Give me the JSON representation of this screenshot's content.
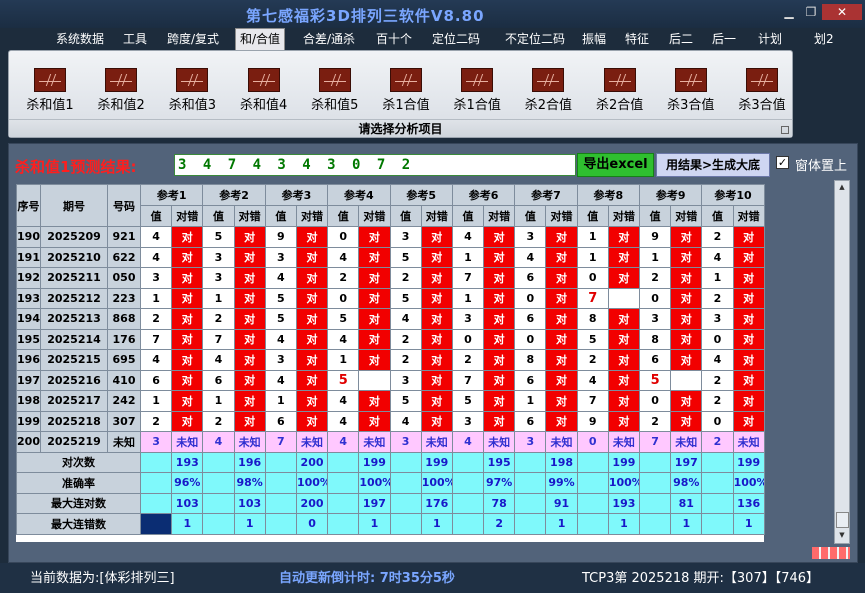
{
  "app": {
    "title": "第七感福彩3D排列三软件V8.80"
  },
  "window_icons": [
    "minimize-icon",
    "restore-icon",
    "close-icon"
  ],
  "menu": [
    "系统数据",
    "工具",
    "跨度/复式",
    "和/合值",
    "合差/通杀",
    "百十个",
    "定位二码",
    "不定位二码",
    "振幅",
    "特征",
    "后二",
    "后一",
    "计划",
    "划2"
  ],
  "ribbon": {
    "buttons": [
      "杀和值1",
      "杀和值2",
      "杀和值3",
      "杀和值4",
      "杀和值5",
      "杀1合值",
      "杀1合值",
      "杀2合值",
      "杀2合值",
      "杀3合值",
      "杀3合值"
    ],
    "caption": "请选择分析项目"
  },
  "result": {
    "label": "杀和值1预测结果:",
    "value": "3 4 7 4 3 4 3 0 7 2",
    "excel_button": "导出excel",
    "generate_button": "用结果>生成大底",
    "always_on_top": "窗体置上",
    "always_on_top_checked": true
  },
  "table": {
    "col_headers": [
      "序号",
      "期号",
      "号码"
    ],
    "ref_headers": [
      "参考1",
      "参考2",
      "参考3",
      "参考4",
      "参考5",
      "参考6",
      "参考7",
      "参考8",
      "参考9",
      "参考10"
    ],
    "sub_value": "值",
    "sub_check": "对错",
    "ok_text": "对",
    "rows": [
      {
        "seq": "190",
        "issue": "2025209",
        "num": "921",
        "vals": [
          "4",
          "5",
          "9",
          "0",
          "3",
          "4",
          "3",
          "1",
          "9",
          "2"
        ],
        "miss": []
      },
      {
        "seq": "191",
        "issue": "2025210",
        "num": "622",
        "vals": [
          "4",
          "3",
          "3",
          "4",
          "5",
          "1",
          "4",
          "1",
          "1",
          "4"
        ],
        "miss": []
      },
      {
        "seq": "192",
        "issue": "2025211",
        "num": "050",
        "vals": [
          "3",
          "3",
          "4",
          "2",
          "2",
          "7",
          "6",
          "0",
          "2",
          "1"
        ],
        "miss": []
      },
      {
        "seq": "193",
        "issue": "2025212",
        "num": "223",
        "vals": [
          "1",
          "1",
          "5",
          "0",
          "5",
          "1",
          "0",
          "7",
          "0",
          "2"
        ],
        "miss": [
          7
        ]
      },
      {
        "seq": "194",
        "issue": "2025213",
        "num": "868",
        "vals": [
          "2",
          "2",
          "5",
          "5",
          "4",
          "3",
          "6",
          "8",
          "3",
          "3"
        ],
        "miss": []
      },
      {
        "seq": "195",
        "issue": "2025214",
        "num": "176",
        "vals": [
          "7",
          "7",
          "4",
          "4",
          "2",
          "0",
          "0",
          "5",
          "8",
          "0"
        ],
        "miss": []
      },
      {
        "seq": "196",
        "issue": "2025215",
        "num": "695",
        "vals": [
          "4",
          "4",
          "3",
          "1",
          "2",
          "2",
          "8",
          "2",
          "6",
          "4"
        ],
        "miss": []
      },
      {
        "seq": "197",
        "issue": "2025216",
        "num": "410",
        "vals": [
          "6",
          "6",
          "4",
          "5",
          "3",
          "7",
          "6",
          "4",
          "5",
          "2"
        ],
        "miss": [
          3,
          8
        ]
      },
      {
        "seq": "198",
        "issue": "2025217",
        "num": "242",
        "vals": [
          "1",
          "1",
          "1",
          "4",
          "5",
          "5",
          "1",
          "7",
          "0",
          "2"
        ],
        "miss": []
      },
      {
        "seq": "199",
        "issue": "2025218",
        "num": "307",
        "vals": [
          "2",
          "2",
          "6",
          "4",
          "4",
          "3",
          "6",
          "9",
          "2",
          "0"
        ],
        "miss": []
      }
    ],
    "pending": {
      "seq": "200",
      "issue": "2025219",
      "num": "未知",
      "vals": [
        "3",
        "4",
        "7",
        "4",
        "3",
        "4",
        "3",
        "0",
        "7",
        "2"
      ],
      "unknown": "未知"
    },
    "stats": [
      {
        "label": "对次数",
        "vals": [
          "193",
          "196",
          "200",
          "199",
          "199",
          "195",
          "198",
          "199",
          "197",
          "199"
        ]
      },
      {
        "label": "准确率",
        "vals": [
          "96%",
          "98%",
          "100%",
          "100%",
          "100%",
          "97%",
          "99%",
          "100%",
          "98%",
          "100%"
        ]
      },
      {
        "label": "最大连对数",
        "vals": [
          "103",
          "103",
          "200",
          "197",
          "176",
          "78",
          "91",
          "193",
          "81",
          "136"
        ]
      },
      {
        "label": "最大连错数",
        "vals": [
          "1",
          "1",
          "0",
          "1",
          "1",
          "2",
          "1",
          "1",
          "1",
          "1"
        ]
      }
    ]
  },
  "status": {
    "data_source": "当前数据为:[体彩排列三]",
    "countdown": "自动更新倒计时: 7时35分5秒",
    "latest": "TCP3第 2025218 期开:【307】【746】"
  }
}
